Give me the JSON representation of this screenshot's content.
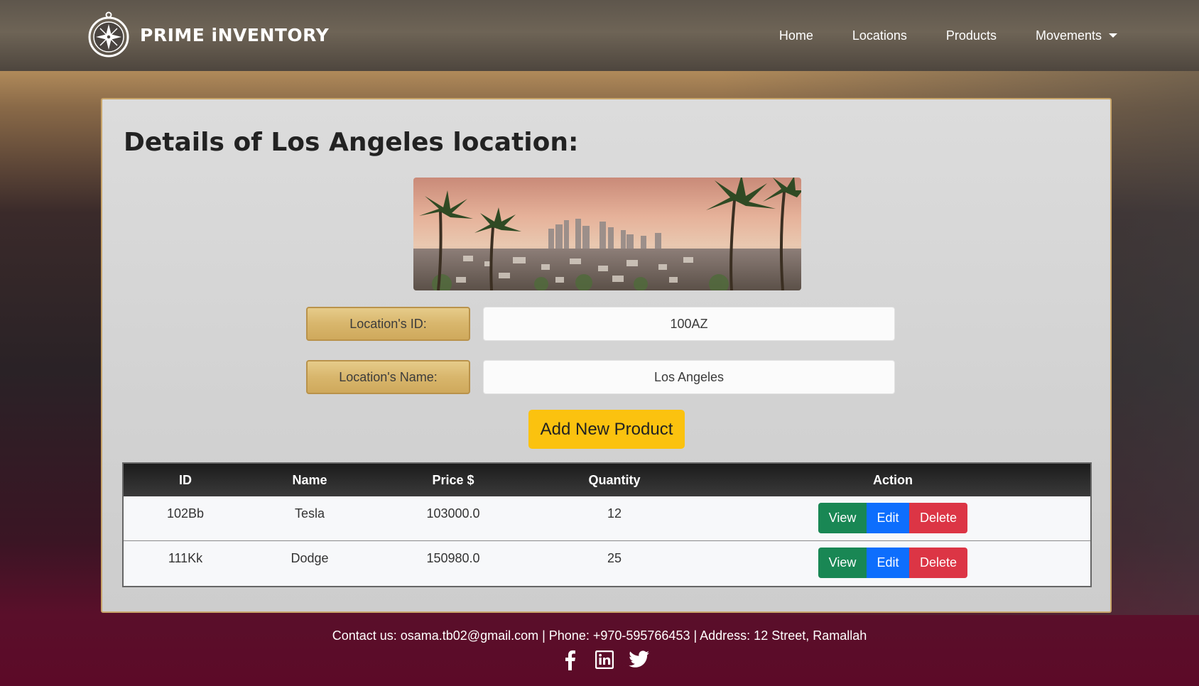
{
  "brand": {
    "name": "PRIME iNVENTORY"
  },
  "nav": {
    "items": [
      {
        "label": "Home"
      },
      {
        "label": "Locations"
      },
      {
        "label": "Products"
      },
      {
        "label": "Movements"
      }
    ]
  },
  "page": {
    "title": "Details of Los Angeles location:",
    "hero_image": "los-angeles-skyline-palm-trees"
  },
  "fields": {
    "id_label": "Location's ID:",
    "id_value": "100AZ",
    "name_label": "Location's Name:",
    "name_value": "Los Angeles"
  },
  "add_button": "Add New Product",
  "table": {
    "headers": [
      "ID",
      "Name",
      "Price $",
      "Quantity",
      "Action"
    ],
    "rows": [
      {
        "id": "102Bb",
        "name": "Tesla",
        "price": "103000.0",
        "quantity": "12"
      },
      {
        "id": "111Kk",
        "name": "Dodge",
        "price": "150980.0",
        "quantity": "25"
      }
    ],
    "actions": {
      "view": "View",
      "edit": "Edit",
      "delete": "Delete"
    }
  },
  "footer": {
    "contact": "Contact us: osama.tb02@gmail.com | Phone: +970-595766453 | Address: 12 Street, Ramallah",
    "socials": [
      "facebook-icon",
      "linkedin-icon",
      "twitter-icon"
    ]
  },
  "colors": {
    "accent_gold": "#d8b66c",
    "add_button": "#fbc20f",
    "view": "#198754",
    "edit": "#0d6efd",
    "delete": "#dc3545"
  }
}
